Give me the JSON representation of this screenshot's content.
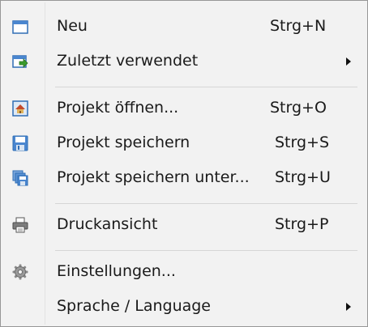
{
  "menu": {
    "items": [
      {
        "label": "Neu",
        "shortcut": "Strg+N",
        "icon": "new-document-icon"
      },
      {
        "label": "Zuletzt verwendet",
        "icon": "recent-files-icon",
        "submenu": true
      },
      {
        "label": "Projekt öffnen...",
        "shortcut": "Strg+O",
        "icon": "open-project-icon"
      },
      {
        "label": "Projekt speichern",
        "shortcut": "Strg+S",
        "icon": "save-icon"
      },
      {
        "label": "Projekt speichern unter...",
        "shortcut": "Strg+U",
        "icon": "save-as-icon"
      },
      {
        "label": "Druckansicht",
        "shortcut": "Strg+P",
        "icon": "printer-icon"
      },
      {
        "label": "Einstellungen...",
        "icon": "gear-icon"
      },
      {
        "label": "Sprache / Language",
        "submenu": true
      }
    ]
  },
  "colors": {
    "menu_background": "#f2f2f2",
    "border": "#979797",
    "separator": "#d6d6d6",
    "icon_blue": "#2f6db5",
    "icon_green": "#3a9b2c"
  }
}
